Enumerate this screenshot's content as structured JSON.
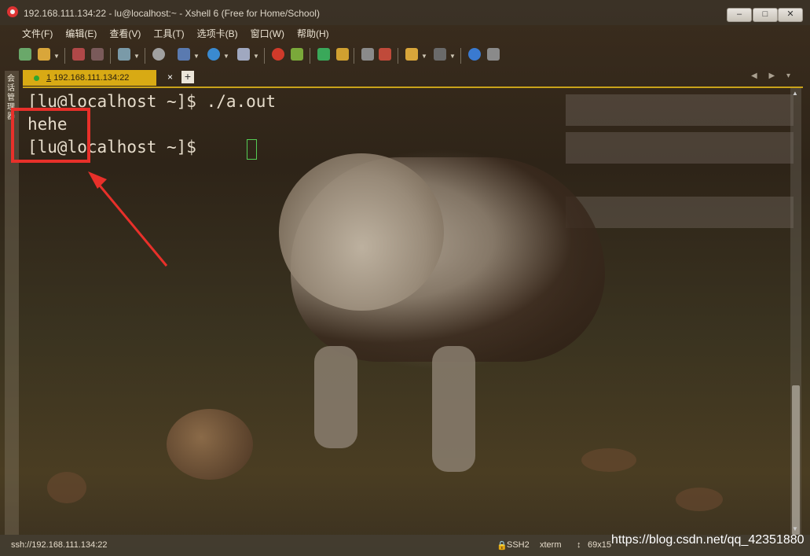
{
  "window": {
    "title": "192.168.111.134:22 - lu@localhost:~ - Xshell 6 (Free for Home/School)",
    "minimize_label": "–",
    "maximize_label": "□",
    "close_label": "✕"
  },
  "menu": {
    "items": [
      "文件(F)",
      "编辑(E)",
      "查看(V)",
      "工具(T)",
      "选项卡(B)",
      "窗口(W)",
      "帮助(H)"
    ]
  },
  "side_panel": {
    "label": "会话管理器"
  },
  "tabs": {
    "items": [
      {
        "number": "1",
        "label": "192.168.111.134:22",
        "status_color": "#2fa62f"
      }
    ],
    "add_label": "+",
    "close_label": "×",
    "nav_label": "◀ ▶ ▾"
  },
  "terminal": {
    "lines": [
      "[lu@localhost ~]$ ./a.out",
      "hehe",
      "[lu@localhost ~]$ "
    ],
    "cursor_color": "#55cc55"
  },
  "annotation": {
    "color": "#e8302a"
  },
  "status": {
    "connection": "ssh://192.168.111.134:22",
    "protocol": "SSH2",
    "terminal_type": "xterm",
    "size": "69x15",
    "watermark": "https://blog.csdn.net/qq_42351880"
  },
  "icons": [
    "new-session-icon",
    "open-folder-icon",
    "link-icon",
    "unlink-icon",
    "transfer-icon",
    "search-icon",
    "properties-icon",
    "globe-icon",
    "font-icon",
    "xftp-icon",
    "xmanager-icon",
    "fullscreen-icon",
    "lock-icon",
    "keyboard-icon",
    "highlight-icon",
    "compose-icon",
    "layout-icon",
    "help-icon",
    "chat-icon"
  ]
}
